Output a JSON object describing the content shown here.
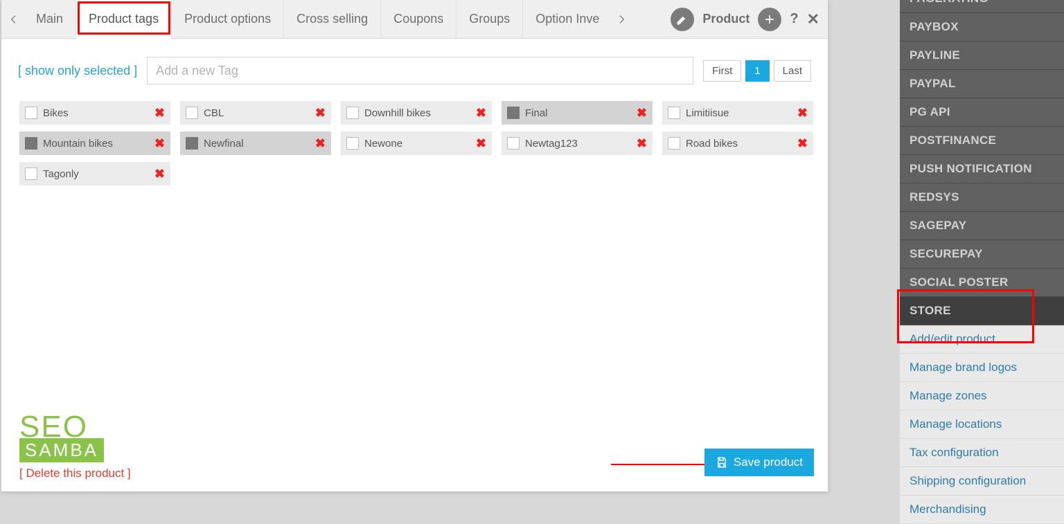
{
  "tabs": {
    "items": [
      "Main",
      "Product tags",
      "Product options",
      "Cross selling",
      "Coupons",
      "Groups",
      "Option Inve"
    ],
    "active_index": 1,
    "right_label": "Product"
  },
  "toolbar": {
    "show_selected": "show only selected",
    "tag_placeholder": "Add a new Tag",
    "pager": {
      "first": "First",
      "page": "1",
      "last": "Last"
    }
  },
  "tags": [
    {
      "label": "Bikes",
      "checked": false
    },
    {
      "label": "CBL",
      "checked": false
    },
    {
      "label": "Downhill bikes",
      "checked": false
    },
    {
      "label": "Final",
      "checked": true
    },
    {
      "label": "Limitiisue",
      "checked": false
    },
    {
      "label": "Mountain bikes",
      "checked": true
    },
    {
      "label": "Newfinal",
      "checked": true
    },
    {
      "label": "Newone",
      "checked": false
    },
    {
      "label": "Newtag123",
      "checked": false
    },
    {
      "label": "Road bikes",
      "checked": false
    },
    {
      "label": "Tagonly",
      "checked": false
    }
  ],
  "footer": {
    "logo_top": "SEO",
    "logo_bottom": "SAMBA",
    "delete": "Delete this product",
    "save": "Save product"
  },
  "sidebar": {
    "groups": [
      {
        "label": "PAGERATING",
        "type": "head"
      },
      {
        "label": "PAYBOX",
        "type": "head"
      },
      {
        "label": "PAYLINE",
        "type": "head"
      },
      {
        "label": "PAYPAL",
        "type": "head"
      },
      {
        "label": "PG API",
        "type": "head"
      },
      {
        "label": "POSTFINANCE",
        "type": "head"
      },
      {
        "label": "PUSH NOTIFICATION",
        "type": "head"
      },
      {
        "label": "REDSYS",
        "type": "head"
      },
      {
        "label": "SAGEPAY",
        "type": "head"
      },
      {
        "label": "SECUREPAY",
        "type": "head"
      },
      {
        "label": "SOCIAL POSTER",
        "type": "head"
      },
      {
        "label": "STORE",
        "type": "head-dark"
      },
      {
        "label": "Add/edit product",
        "type": "sub"
      },
      {
        "label": "Manage brand logos",
        "type": "sub"
      },
      {
        "label": "Manage zones",
        "type": "sub"
      },
      {
        "label": "Manage locations",
        "type": "sub"
      },
      {
        "label": "Tax configuration",
        "type": "sub"
      },
      {
        "label": "Shipping configuration",
        "type": "sub"
      },
      {
        "label": "Merchandising",
        "type": "sub"
      }
    ]
  }
}
